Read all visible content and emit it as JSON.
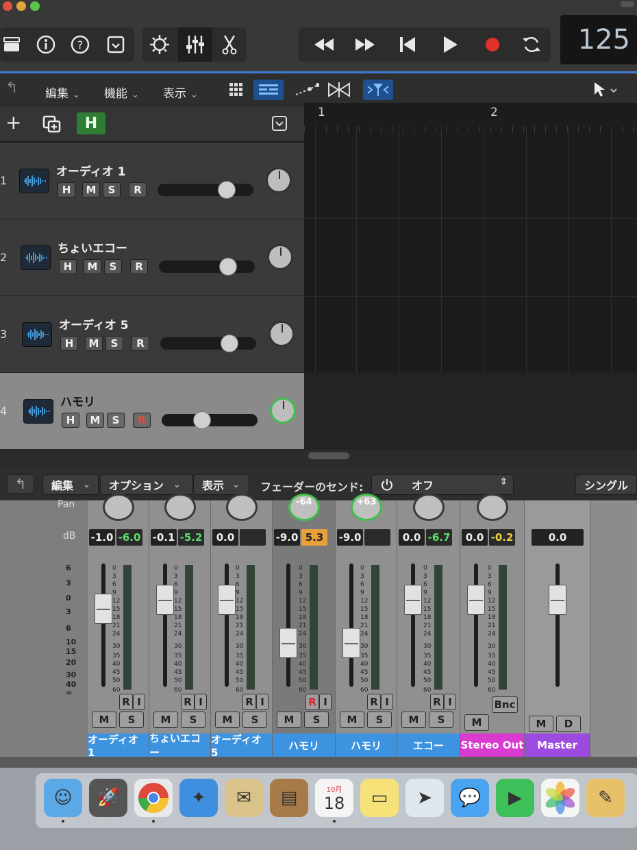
{
  "transport": {
    "tempo": "125",
    "colors": {
      "record": "#e0322a",
      "accent": "#3b7bd6"
    }
  },
  "toolbar_icons": [
    "library-icon",
    "info-icon",
    "help-icon",
    "inbox-icon",
    "smart-controls-icon",
    "mixer-icon",
    "scissors-icon"
  ],
  "transport_icons": [
    "rewind-icon",
    "fast-forward-icon",
    "go-to-start-icon",
    "play-icon",
    "record-icon",
    "cycle-icon"
  ],
  "track_menu": {
    "edit": "編集",
    "function": "機能",
    "view": "表示",
    "chevron": "⌄"
  },
  "track_header": {
    "add": "+",
    "hide": "H"
  },
  "ruler": {
    "bar1": "1",
    "bar2": "2"
  },
  "tracks": [
    {
      "num": "1",
      "name": "オーディオ 1",
      "H": "H",
      "M": "M",
      "S": "S",
      "R": "R",
      "volume": 0.72
    },
    {
      "num": "2",
      "name": "ちょいエコー",
      "H": "H",
      "M": "M",
      "S": "S",
      "R": "R",
      "volume": 0.72
    },
    {
      "num": "3",
      "name": "オーディオ 5",
      "H": "H",
      "M": "M",
      "S": "S",
      "R": "R",
      "volume": 0.72
    },
    {
      "num": "4",
      "name": "ハモリ",
      "H": "H",
      "M": "M",
      "S": "S",
      "R": "R",
      "volume": 0.42
    }
  ],
  "mixer_menu": {
    "edit": "編集",
    "options": "オプション",
    "view": "表示",
    "sends_label": "フェーダーのセンド:",
    "sends_value": "オフ",
    "single": "シングル"
  },
  "mixer_labels": {
    "pan": "Pan",
    "db": "dB"
  },
  "mixer_scale": [
    "6",
    "3",
    "0",
    "3",
    "6",
    "10",
    "15",
    "20",
    "30",
    "40",
    "∞"
  ],
  "meter_scale": [
    "0",
    "3",
    "6",
    "9",
    "12",
    "15",
    "18",
    "21",
    "24",
    "30",
    "35",
    "40",
    "45",
    "50",
    "60"
  ],
  "strips": [
    {
      "name": "オーディオ 1",
      "pan": "",
      "db": "-1.0",
      "peak": "-6.0",
      "peak_style": "green",
      "fader": 0.7,
      "R": "R",
      "I": "I",
      "M": "M",
      "S": "S"
    },
    {
      "name": "ちょいエコー",
      "pan": "",
      "db": "-0.1",
      "peak": "-5.2",
      "peak_style": "green",
      "fader": 0.77,
      "R": "R",
      "I": "I",
      "M": "M",
      "S": "S"
    },
    {
      "name": "オーディオ 5",
      "pan": "",
      "db": "0.0",
      "peak": "",
      "peak_style": "none",
      "fader": 0.77,
      "R": "R",
      "I": "I",
      "M": "M",
      "S": "S"
    },
    {
      "name": "ハモリ",
      "pan": "-64",
      "db": "-9.0",
      "peak": "5.3",
      "peak_style": "orange",
      "fader": 0.42,
      "R": "R",
      "I": "I",
      "M": "M",
      "S": "S"
    },
    {
      "name": "ハモリ",
      "pan": "+63",
      "db": "-9.0",
      "peak": "",
      "peak_style": "none",
      "fader": 0.42,
      "R": "R",
      "I": "I",
      "M": "M",
      "S": "S"
    },
    {
      "name": "エコー",
      "pan": "",
      "db": "0.0",
      "peak": "-6.7",
      "peak_style": "green",
      "fader": 0.77,
      "R": "R",
      "I": "I",
      "M": "M",
      "S": "S"
    },
    {
      "name": "Stereo Out",
      "pan": "",
      "db": "0.0",
      "peak": "-0.2",
      "peak_style": "yellow",
      "fader": 0.77,
      "Bnc": "Bnc",
      "M": "M"
    },
    {
      "name": "Master",
      "db": "0.0",
      "fader": 0.77,
      "M": "M",
      "D": "D"
    }
  ],
  "dock": {
    "calendar_month": "10月",
    "calendar_day": "18",
    "apps": [
      "finder-icon",
      "launchpad-icon",
      "chrome-icon",
      "safari-icon",
      "mail-icon",
      "contacts-icon",
      "calendar-icon",
      "notes-icon",
      "maps-icon",
      "messages-icon",
      "facetime-icon",
      "photos-icon",
      "preview-icon"
    ]
  }
}
